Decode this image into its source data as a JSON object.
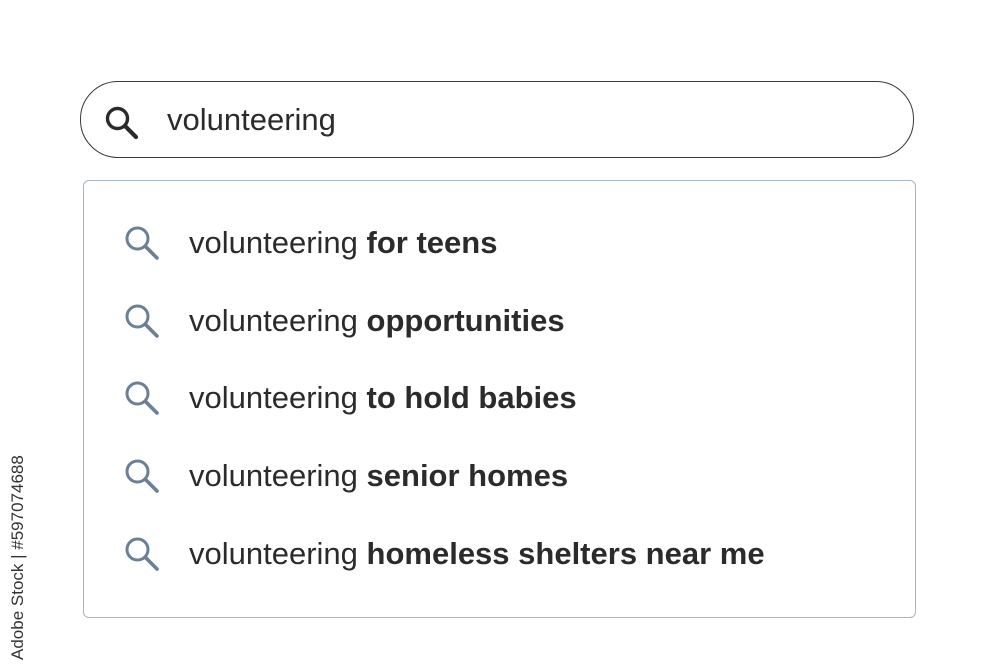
{
  "search": {
    "value": "volunteering"
  },
  "suggestions": [
    {
      "query": "volunteering",
      "completion": "for teens"
    },
    {
      "query": "volunteering",
      "completion": "opportunities"
    },
    {
      "query": "volunteering",
      "completion": "to hold babies"
    },
    {
      "query": "volunteering",
      "completion": "senior homes"
    },
    {
      "query": "volunteering",
      "completion": "homeless shelters near me"
    }
  ],
  "watermark": {
    "side_text": "Adobe Stock | #597074688"
  },
  "colors": {
    "search_icon": "#2b2b2b",
    "suggestion_icon": "#6b7f95",
    "suggest_border": "#a9b6c6",
    "text": "#2b2b2b"
  },
  "icons": {
    "search_bar": "search-icon",
    "suggestion": "search-icon"
  }
}
